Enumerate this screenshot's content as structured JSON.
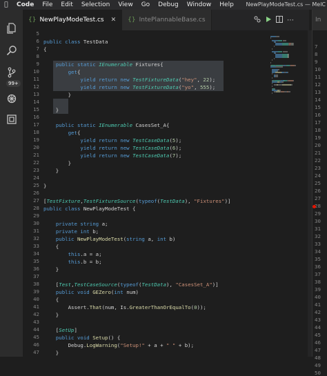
{
  "menubar": {
    "app": "Code",
    "items": [
      "File",
      "Edit",
      "Selection",
      "View",
      "Go",
      "Debug",
      "Window",
      "Help"
    ],
    "window_title": "NewPlayModeTest.cs — MelC"
  },
  "activity_bar": {
    "badge": "99+"
  },
  "tabs": [
    {
      "label": "NewPlayModeTest.cs",
      "active": true
    },
    {
      "label": "IntePlannableBase.cs",
      "active": false
    }
  ],
  "split_editor": {
    "tab_label": "In"
  },
  "colors": {
    "keyword": "#569cd6",
    "type": "#4ec9b0",
    "function": "#dcdcaa",
    "string": "#ce9178",
    "number": "#b5cea8",
    "breakpoint": "#e51400"
  },
  "code_lines": [
    {
      "n": 5,
      "tokens": []
    },
    {
      "n": 6,
      "tokens": [
        [
          "kw",
          "public class "
        ],
        [
          "pl",
          "TestData"
        ]
      ]
    },
    {
      "n": 7,
      "tokens": [
        [
          "pl",
          "{"
        ]
      ]
    },
    {
      "n": 8,
      "tokens": []
    },
    {
      "n": 9,
      "tokens": [
        [
          "pl",
          "    "
        ],
        [
          "kw",
          "public static "
        ],
        [
          "cls",
          "IEnumerable"
        ],
        [
          "pl",
          " Fixtures{"
        ]
      ]
    },
    {
      "n": 10,
      "tokens": [
        [
          "pl",
          "        "
        ],
        [
          "kw",
          "get"
        ],
        [
          "pl",
          "{"
        ]
      ]
    },
    {
      "n": 11,
      "tokens": [
        [
          "pl",
          "            "
        ],
        [
          "kw",
          "yield return new "
        ],
        [
          "cls",
          "TestFixtureData"
        ],
        [
          "pl",
          "("
        ],
        [
          "str",
          "\"hey\""
        ],
        [
          "pl",
          ", "
        ],
        [
          "num",
          "22"
        ],
        [
          "pl",
          ");"
        ]
      ]
    },
    {
      "n": 12,
      "tokens": [
        [
          "pl",
          "            "
        ],
        [
          "kw",
          "yield return new "
        ],
        [
          "cls",
          "TestFixtureData"
        ],
        [
          "pl",
          "("
        ],
        [
          "str",
          "\"yo\""
        ],
        [
          "pl",
          ", "
        ],
        [
          "num",
          "555"
        ],
        [
          "pl",
          ");"
        ]
      ]
    },
    {
      "n": 13,
      "tokens": [
        [
          "pl",
          "        }"
        ]
      ]
    },
    {
      "n": 14,
      "tokens": []
    },
    {
      "n": 15,
      "tokens": [
        [
          "pl",
          "    }"
        ]
      ]
    },
    {
      "n": 16,
      "tokens": []
    },
    {
      "n": 17,
      "tokens": [
        [
          "pl",
          "    "
        ],
        [
          "kw",
          "public static "
        ],
        [
          "cls",
          "IEnumerable"
        ],
        [
          "pl",
          " CasesSet_A{"
        ]
      ]
    },
    {
      "n": 18,
      "tokens": [
        [
          "pl",
          "        "
        ],
        [
          "kw",
          "get"
        ],
        [
          "pl",
          "{"
        ]
      ]
    },
    {
      "n": 19,
      "tokens": [
        [
          "pl",
          "            "
        ],
        [
          "kw",
          "yield return new "
        ],
        [
          "cls",
          "TestCaseData"
        ],
        [
          "pl",
          "("
        ],
        [
          "num",
          "5"
        ],
        [
          "pl",
          ");"
        ]
      ]
    },
    {
      "n": 20,
      "tokens": [
        [
          "pl",
          "            "
        ],
        [
          "kw",
          "yield return new "
        ],
        [
          "cls",
          "TestCaseData"
        ],
        [
          "pl",
          "("
        ],
        [
          "num",
          "6"
        ],
        [
          "pl",
          ");"
        ]
      ]
    },
    {
      "n": 21,
      "tokens": [
        [
          "pl",
          "            "
        ],
        [
          "kw",
          "yield return new "
        ],
        [
          "cls",
          "TestCaseData"
        ],
        [
          "pl",
          "("
        ],
        [
          "num",
          "7"
        ],
        [
          "pl",
          ");"
        ]
      ]
    },
    {
      "n": 22,
      "tokens": [
        [
          "pl",
          "        }"
        ]
      ]
    },
    {
      "n": 23,
      "tokens": [
        [
          "pl",
          "    }"
        ]
      ]
    },
    {
      "n": 24,
      "tokens": []
    },
    {
      "n": 25,
      "tokens": [
        [
          "pl",
          "}"
        ]
      ]
    },
    {
      "n": 26,
      "tokens": []
    },
    {
      "n": 27,
      "tokens": [
        [
          "pl",
          "["
        ],
        [
          "cls",
          "TestFixture"
        ],
        [
          "pl",
          ","
        ],
        [
          "cls",
          "TestFixtureSource"
        ],
        [
          "pl",
          "("
        ],
        [
          "kw",
          "typeof"
        ],
        [
          "pl",
          "("
        ],
        [
          "cls",
          "TestData"
        ],
        [
          "pl",
          "), "
        ],
        [
          "str",
          "\"Fixtures\""
        ],
        [
          "pl",
          ")]"
        ]
      ]
    },
    {
      "n": 28,
      "tokens": [
        [
          "kw",
          "public class "
        ],
        [
          "pl",
          "NewPlayModeTest {"
        ]
      ]
    },
    {
      "n": 29,
      "tokens": []
    },
    {
      "n": 30,
      "tokens": [
        [
          "pl",
          "    "
        ],
        [
          "kw",
          "private string "
        ],
        [
          "pl",
          "a;"
        ]
      ]
    },
    {
      "n": 31,
      "tokens": [
        [
          "pl",
          "    "
        ],
        [
          "kw",
          "private int "
        ],
        [
          "pl",
          "b;"
        ]
      ]
    },
    {
      "n": 32,
      "tokens": [
        [
          "pl",
          "    "
        ],
        [
          "kw",
          "public "
        ],
        [
          "fn",
          "NewPlayModeTest"
        ],
        [
          "pl",
          "("
        ],
        [
          "kw",
          "string "
        ],
        [
          "pl",
          "a, "
        ],
        [
          "kw",
          "int "
        ],
        [
          "pl",
          "b)"
        ]
      ]
    },
    {
      "n": 33,
      "tokens": [
        [
          "pl",
          "    {"
        ]
      ]
    },
    {
      "n": 34,
      "tokens": [
        [
          "pl",
          "        "
        ],
        [
          "kw",
          "this"
        ],
        [
          "pl",
          ".a = a;"
        ]
      ]
    },
    {
      "n": 35,
      "tokens": [
        [
          "pl",
          "        "
        ],
        [
          "kw",
          "this"
        ],
        [
          "pl",
          ".b = b;"
        ]
      ]
    },
    {
      "n": 36,
      "tokens": [
        [
          "pl",
          "    }"
        ]
      ]
    },
    {
      "n": 37,
      "tokens": []
    },
    {
      "n": 38,
      "tokens": [
        [
          "pl",
          "    ["
        ],
        [
          "cls",
          "Test"
        ],
        [
          "pl",
          ","
        ],
        [
          "cls",
          "TestCaseSource"
        ],
        [
          "pl",
          "("
        ],
        [
          "kw",
          "typeof"
        ],
        [
          "pl",
          "("
        ],
        [
          "cls",
          "TestData"
        ],
        [
          "pl",
          "), "
        ],
        [
          "str",
          "\"CasesSet_A\""
        ],
        [
          "pl",
          ")]"
        ]
      ]
    },
    {
      "n": 39,
      "tokens": [
        [
          "pl",
          "    "
        ],
        [
          "kw",
          "public void "
        ],
        [
          "fn",
          "GEZero"
        ],
        [
          "pl",
          "("
        ],
        [
          "kw",
          "int "
        ],
        [
          "pl",
          "num)"
        ]
      ]
    },
    {
      "n": 40,
      "tokens": [
        [
          "pl",
          "    {"
        ]
      ]
    },
    {
      "n": 41,
      "tokens": [
        [
          "pl",
          "        Assert."
        ],
        [
          "fn",
          "That"
        ],
        [
          "pl",
          "(num, Is."
        ],
        [
          "fn",
          "GreaterThanOrEqualTo"
        ],
        [
          "pl",
          "("
        ],
        [
          "num",
          "0"
        ],
        [
          "pl",
          "));"
        ]
      ]
    },
    {
      "n": 42,
      "tokens": [
        [
          "pl",
          "    }"
        ]
      ]
    },
    {
      "n": 43,
      "tokens": []
    },
    {
      "n": 44,
      "tokens": [
        [
          "pl",
          "    ["
        ],
        [
          "cls",
          "SetUp"
        ],
        [
          "pl",
          "]"
        ]
      ]
    },
    {
      "n": 45,
      "tokens": [
        [
          "pl",
          "    "
        ],
        [
          "kw",
          "public void "
        ],
        [
          "fn",
          "Setup"
        ],
        [
          "pl",
          "() {"
        ]
      ]
    },
    {
      "n": 46,
      "tokens": [
        [
          "pl",
          "        Debug."
        ],
        [
          "fn",
          "LogWarning"
        ],
        [
          "pl",
          "("
        ],
        [
          "str",
          "\"Setup!\""
        ],
        [
          "pl",
          " + a + "
        ],
        [
          "str",
          "\" \""
        ],
        [
          "pl",
          " + b);"
        ]
      ]
    },
    {
      "n": 47,
      "tokens": [
        [
          "pl",
          "    }"
        ]
      ]
    },
    {
      "n": 48,
      "tokens": []
    }
  ],
  "split_line_numbers": [
    "7",
    "8",
    "9",
    "10",
    "11",
    "12",
    "13",
    "14",
    "15",
    "16",
    "17",
    "18",
    "19",
    "20",
    "21",
    "22",
    "23",
    "24",
    "25",
    "26",
    "27",
    "28",
    "29",
    "30",
    "31",
    "32",
    "33",
    "34",
    "35",
    "36",
    "37",
    "38",
    "39",
    "40",
    "41",
    "42",
    "43",
    "44",
    "45",
    "46",
    "47",
    "48",
    "49",
    "50"
  ]
}
